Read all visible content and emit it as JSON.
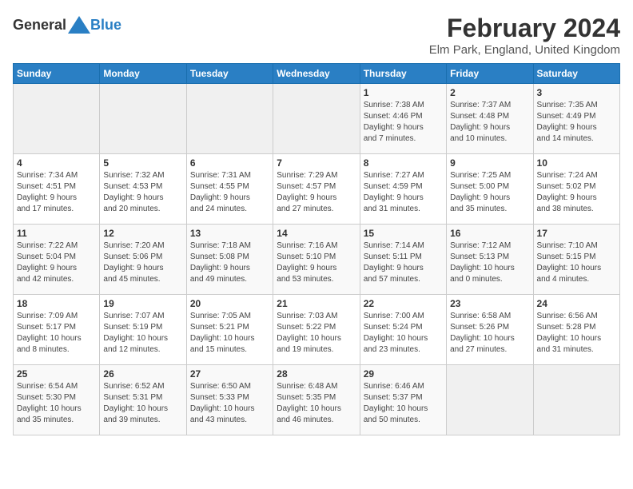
{
  "header": {
    "logo_general": "General",
    "logo_blue": "Blue",
    "title": "February 2024",
    "subtitle": "Elm Park, England, United Kingdom"
  },
  "days_of_week": [
    "Sunday",
    "Monday",
    "Tuesday",
    "Wednesday",
    "Thursday",
    "Friday",
    "Saturday"
  ],
  "weeks": [
    [
      {
        "day": "",
        "content": ""
      },
      {
        "day": "",
        "content": ""
      },
      {
        "day": "",
        "content": ""
      },
      {
        "day": "",
        "content": ""
      },
      {
        "day": "1",
        "content": "Sunrise: 7:38 AM\nSunset: 4:46 PM\nDaylight: 9 hours\nand 7 minutes."
      },
      {
        "day": "2",
        "content": "Sunrise: 7:37 AM\nSunset: 4:48 PM\nDaylight: 9 hours\nand 10 minutes."
      },
      {
        "day": "3",
        "content": "Sunrise: 7:35 AM\nSunset: 4:49 PM\nDaylight: 9 hours\nand 14 minutes."
      }
    ],
    [
      {
        "day": "4",
        "content": "Sunrise: 7:34 AM\nSunset: 4:51 PM\nDaylight: 9 hours\nand 17 minutes."
      },
      {
        "day": "5",
        "content": "Sunrise: 7:32 AM\nSunset: 4:53 PM\nDaylight: 9 hours\nand 20 minutes."
      },
      {
        "day": "6",
        "content": "Sunrise: 7:31 AM\nSunset: 4:55 PM\nDaylight: 9 hours\nand 24 minutes."
      },
      {
        "day": "7",
        "content": "Sunrise: 7:29 AM\nSunset: 4:57 PM\nDaylight: 9 hours\nand 27 minutes."
      },
      {
        "day": "8",
        "content": "Sunrise: 7:27 AM\nSunset: 4:59 PM\nDaylight: 9 hours\nand 31 minutes."
      },
      {
        "day": "9",
        "content": "Sunrise: 7:25 AM\nSunset: 5:00 PM\nDaylight: 9 hours\nand 35 minutes."
      },
      {
        "day": "10",
        "content": "Sunrise: 7:24 AM\nSunset: 5:02 PM\nDaylight: 9 hours\nand 38 minutes."
      }
    ],
    [
      {
        "day": "11",
        "content": "Sunrise: 7:22 AM\nSunset: 5:04 PM\nDaylight: 9 hours\nand 42 minutes."
      },
      {
        "day": "12",
        "content": "Sunrise: 7:20 AM\nSunset: 5:06 PM\nDaylight: 9 hours\nand 45 minutes."
      },
      {
        "day": "13",
        "content": "Sunrise: 7:18 AM\nSunset: 5:08 PM\nDaylight: 9 hours\nand 49 minutes."
      },
      {
        "day": "14",
        "content": "Sunrise: 7:16 AM\nSunset: 5:10 PM\nDaylight: 9 hours\nand 53 minutes."
      },
      {
        "day": "15",
        "content": "Sunrise: 7:14 AM\nSunset: 5:11 PM\nDaylight: 9 hours\nand 57 minutes."
      },
      {
        "day": "16",
        "content": "Sunrise: 7:12 AM\nSunset: 5:13 PM\nDaylight: 10 hours\nand 0 minutes."
      },
      {
        "day": "17",
        "content": "Sunrise: 7:10 AM\nSunset: 5:15 PM\nDaylight: 10 hours\nand 4 minutes."
      }
    ],
    [
      {
        "day": "18",
        "content": "Sunrise: 7:09 AM\nSunset: 5:17 PM\nDaylight: 10 hours\nand 8 minutes."
      },
      {
        "day": "19",
        "content": "Sunrise: 7:07 AM\nSunset: 5:19 PM\nDaylight: 10 hours\nand 12 minutes."
      },
      {
        "day": "20",
        "content": "Sunrise: 7:05 AM\nSunset: 5:21 PM\nDaylight: 10 hours\nand 15 minutes."
      },
      {
        "day": "21",
        "content": "Sunrise: 7:03 AM\nSunset: 5:22 PM\nDaylight: 10 hours\nand 19 minutes."
      },
      {
        "day": "22",
        "content": "Sunrise: 7:00 AM\nSunset: 5:24 PM\nDaylight: 10 hours\nand 23 minutes."
      },
      {
        "day": "23",
        "content": "Sunrise: 6:58 AM\nSunset: 5:26 PM\nDaylight: 10 hours\nand 27 minutes."
      },
      {
        "day": "24",
        "content": "Sunrise: 6:56 AM\nSunset: 5:28 PM\nDaylight: 10 hours\nand 31 minutes."
      }
    ],
    [
      {
        "day": "25",
        "content": "Sunrise: 6:54 AM\nSunset: 5:30 PM\nDaylight: 10 hours\nand 35 minutes."
      },
      {
        "day": "26",
        "content": "Sunrise: 6:52 AM\nSunset: 5:31 PM\nDaylight: 10 hours\nand 39 minutes."
      },
      {
        "day": "27",
        "content": "Sunrise: 6:50 AM\nSunset: 5:33 PM\nDaylight: 10 hours\nand 43 minutes."
      },
      {
        "day": "28",
        "content": "Sunrise: 6:48 AM\nSunset: 5:35 PM\nDaylight: 10 hours\nand 46 minutes."
      },
      {
        "day": "29",
        "content": "Sunrise: 6:46 AM\nSunset: 5:37 PM\nDaylight: 10 hours\nand 50 minutes."
      },
      {
        "day": "",
        "content": ""
      },
      {
        "day": "",
        "content": ""
      }
    ]
  ]
}
